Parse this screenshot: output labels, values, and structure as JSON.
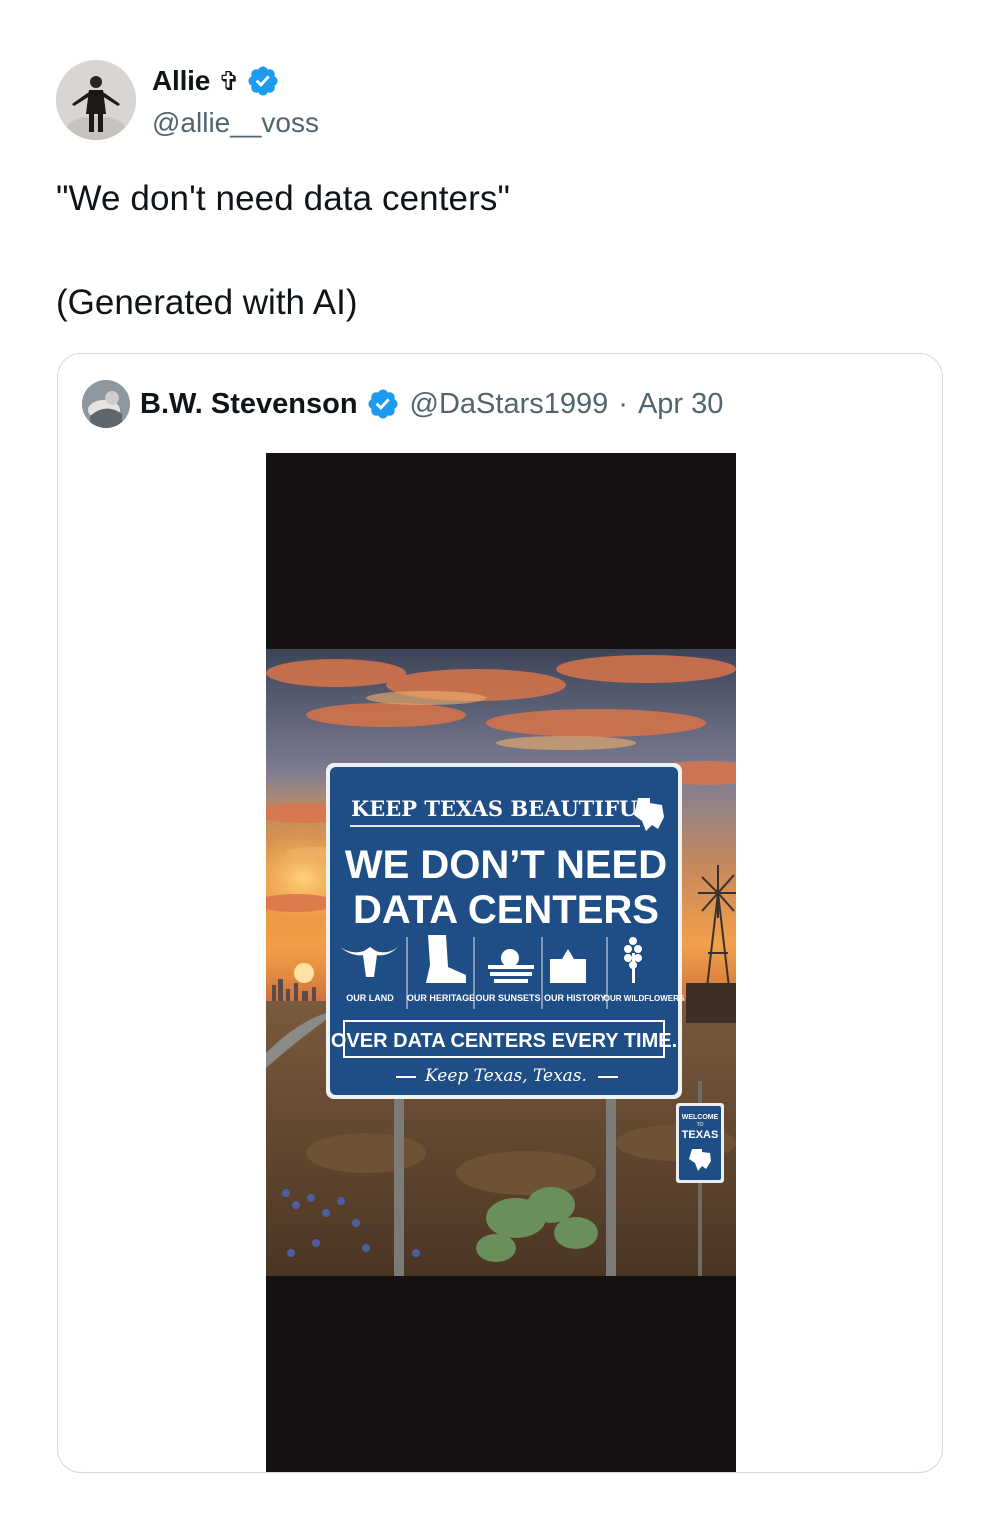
{
  "tweet": {
    "author": {
      "display_name": "Allie",
      "emoji": "✞",
      "handle": "@allie__voss",
      "verified": true,
      "avatar_icon": "avatar-photo-icon"
    },
    "text_line1": "\"We don't need data centers\"",
    "text_line2": "(Generated with AI)"
  },
  "quote": {
    "author": {
      "display_name": "B.W. Stevenson",
      "handle": "@DaStars1999",
      "separator": "·",
      "date": "Apr 30",
      "verified": true
    },
    "media": {
      "sign": {
        "top_line": "KEEP TEXAS BEAUTIFUL",
        "headline_line1": "WE DON’T NEED",
        "headline_line2": "DATA CENTERS",
        "icons": [
          {
            "icon": "longhorn-icon",
            "label": "OUR LAND"
          },
          {
            "icon": "boot-icon",
            "label": "OUR HERITAGE"
          },
          {
            "icon": "sunset-icon",
            "label": "OUR SUNSETS"
          },
          {
            "icon": "alamo-icon",
            "label": "OUR HISTORY"
          },
          {
            "icon": "bluebonnet-icon",
            "label": "OUR WILDFLOWERS"
          }
        ],
        "bottom_banner": "OVER DATA CENTERS EVERY TIME.",
        "signature": "Keep Texas, Texas."
      },
      "small_sign": {
        "line1": "WELCOME",
        "line2": "TO",
        "line3": "TEXAS"
      }
    }
  },
  "colors": {
    "text": "#0f1419",
    "secondary_text": "#536471",
    "verified_blue": "#1d9bf0",
    "card_border": "#cfd9de",
    "sign_blue": "#1f4e86"
  }
}
